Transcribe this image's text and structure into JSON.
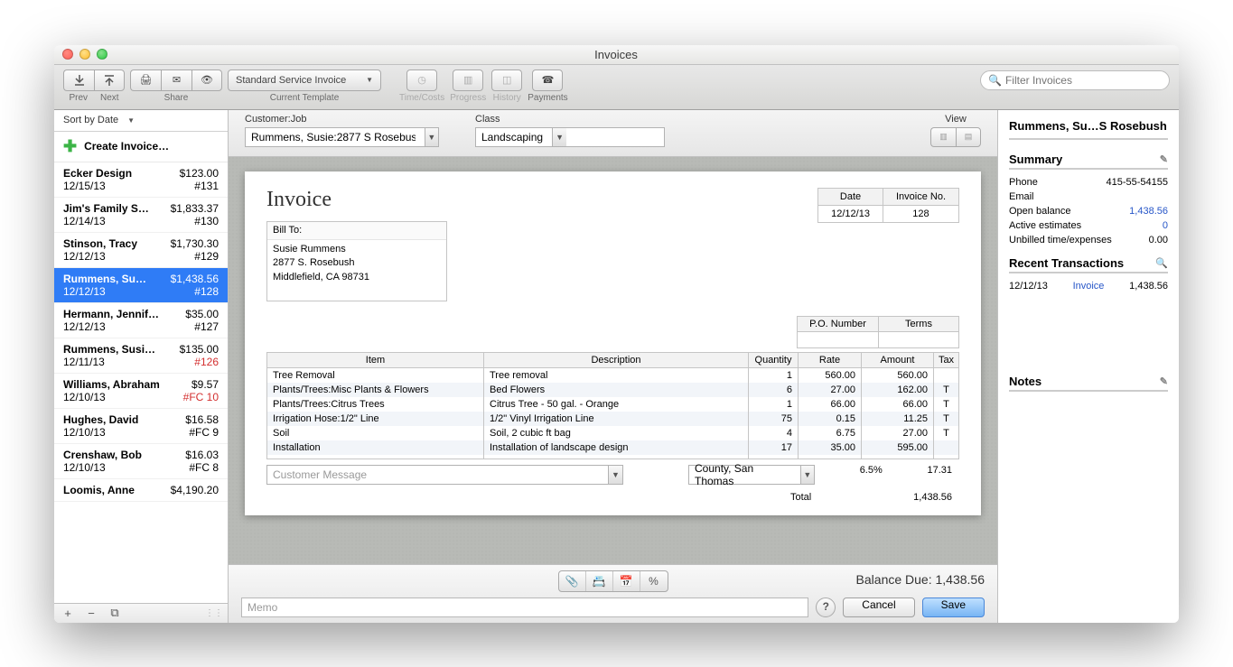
{
  "window": {
    "title": "Invoices"
  },
  "toolbar": {
    "prev": "Prev",
    "next": "Next",
    "share": "Share",
    "template": "Standard Service Invoice",
    "template_label": "Current Template",
    "time_costs": "Time/Costs",
    "progress": "Progress",
    "history": "History",
    "payments": "Payments",
    "search_placeholder": "Filter Invoices"
  },
  "sidebar": {
    "sort": "Sort by Date",
    "create": "Create Invoice…",
    "items": [
      {
        "name": "Ecker Design",
        "amount": "$123.00",
        "date": "12/15/13",
        "num": "#131"
      },
      {
        "name": "Jim's Family S…",
        "amount": "$1,833.37",
        "date": "12/14/13",
        "num": "#130"
      },
      {
        "name": "Stinson, Tracy",
        "amount": "$1,730.30",
        "date": "12/12/13",
        "num": "#129"
      },
      {
        "name": "Rummens, Su…",
        "amount": "$1,438.56",
        "date": "12/12/13",
        "num": "#128",
        "selected": true
      },
      {
        "name": "Hermann, Jennif…",
        "amount": "$35.00",
        "date": "12/12/13",
        "num": "#127"
      },
      {
        "name": "Rummens, Susi…",
        "amount": "$135.00",
        "date": "12/11/13",
        "num": "#126",
        "red": true
      },
      {
        "name": "Williams, Abraham",
        "amount": "$9.57",
        "date": "12/10/13",
        "num": "#FC 10",
        "red": true
      },
      {
        "name": "Hughes, David",
        "amount": "$16.58",
        "date": "12/10/13",
        "num": "#FC 9"
      },
      {
        "name": "Crenshaw, Bob",
        "amount": "$16.03",
        "date": "12/10/13",
        "num": "#FC 8"
      },
      {
        "name": "Loomis, Anne",
        "amount": "$4,190.20",
        "date": "",
        "num": ""
      }
    ]
  },
  "form": {
    "customer_label": "Customer:Job",
    "customer_value": "Rummens, Susie:2877 S Rosebush",
    "class_label": "Class",
    "class_value": "Landscaping",
    "view_label": "View"
  },
  "invoice": {
    "title": "Invoice",
    "date_h": "Date",
    "date": "12/12/13",
    "invno_h": "Invoice No.",
    "invno": "128",
    "billto_h": "Bill To:",
    "billto1": "Susie Rummens",
    "billto2": "2877 S. Rosebush",
    "billto3": "Middlefield, CA  98731",
    "po_h": "P.O. Number",
    "terms_h": "Terms",
    "cols": {
      "item": "Item",
      "desc": "Description",
      "qty": "Quantity",
      "rate": "Rate",
      "amount": "Amount",
      "tax": "Tax"
    },
    "lines": [
      {
        "item": "Tree Removal",
        "desc": "Tree removal",
        "qty": "1",
        "rate": "560.00",
        "amount": "560.00",
        "tax": ""
      },
      {
        "item": "Plants/Trees:Misc Plants & Flowers",
        "desc": "Bed Flowers",
        "qty": "6",
        "rate": "27.00",
        "amount": "162.00",
        "tax": "T"
      },
      {
        "item": "Plants/Trees:Citrus Trees",
        "desc": "Citrus Tree - 50 gal. - Orange",
        "qty": "1",
        "rate": "66.00",
        "amount": "66.00",
        "tax": "T"
      },
      {
        "item": "Irrigation Hose:1/2\" Line",
        "desc": "1/2\"  Vinyl Irrigation Line",
        "qty": "75",
        "rate": "0.15",
        "amount": "11.25",
        "tax": "T"
      },
      {
        "item": "Soil",
        "desc": "Soil, 2 cubic ft bag",
        "qty": "4",
        "rate": "6.75",
        "amount": "27.00",
        "tax": "T"
      },
      {
        "item": "Installation",
        "desc": "Installation of landscape design",
        "qty": "17",
        "rate": "35.00",
        "amount": "595.00",
        "tax": ""
      },
      {
        "item": "",
        "desc": "",
        "qty": "",
        "rate": "",
        "amount": "",
        "tax": ""
      }
    ],
    "cust_msg_ph": "Customer Message",
    "tax_region": "County, San Thomas",
    "tax_pct": "6.5%",
    "tax_amount": "17.31",
    "total_label": "Total",
    "total": "1,438.56"
  },
  "bottom": {
    "balance_label": "Balance Due:",
    "balance": "1,438.56",
    "memo_ph": "Memo",
    "cancel": "Cancel",
    "save": "Save"
  },
  "right": {
    "title": "Rummens, Su…S Rosebush",
    "summary_h": "Summary",
    "phone_l": "Phone",
    "phone_v": "415-55-54155",
    "email_l": "Email",
    "open_l": "Open balance",
    "open_v": "1,438.56",
    "est_l": "Active estimates",
    "est_v": "0",
    "unb_l": "Unbilled time/expenses",
    "unb_v": "0.00",
    "recent_h": "Recent Transactions",
    "recent_date": "12/12/13",
    "recent_type": "Invoice",
    "recent_amount": "1,438.56",
    "notes_h": "Notes"
  }
}
